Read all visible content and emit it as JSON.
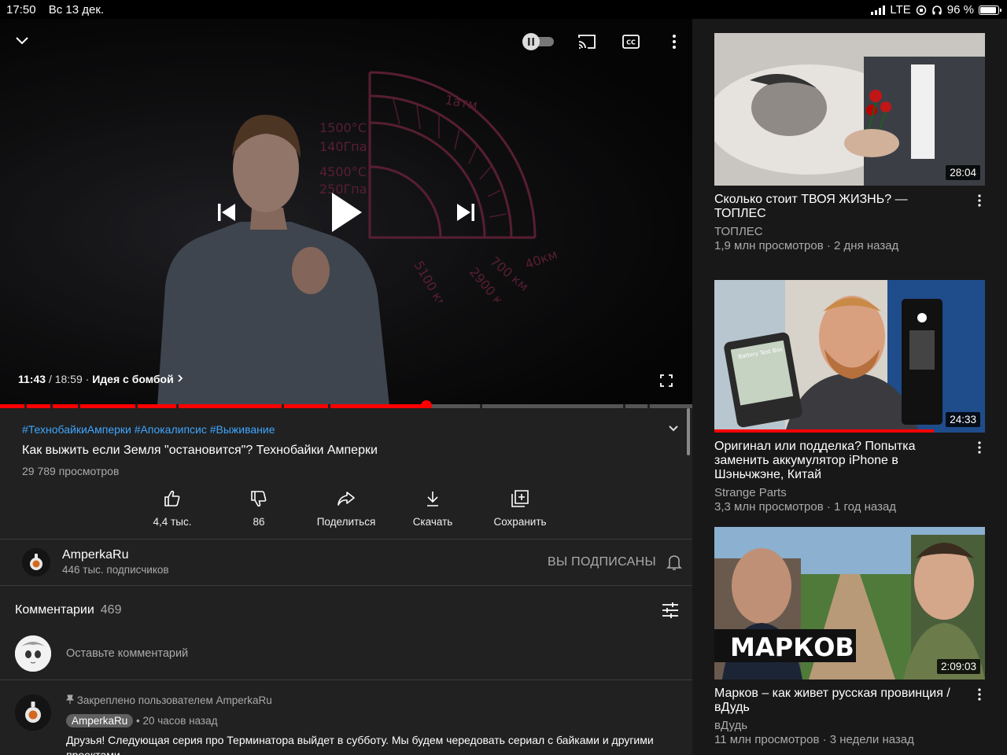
{
  "status_bar": {
    "time": "17:50",
    "date": "Вс 13 дек.",
    "network": "LTE",
    "battery": "96 %",
    "battery_level": 0.96
  },
  "player": {
    "current_time": "11:43",
    "duration": "/ 18:59",
    "separator": "·",
    "chapter": "Идея с бомбой",
    "progress": 0.616,
    "chapter_marks": [
      0.035,
      0.073,
      0.112,
      0.195,
      0.255,
      0.407,
      0.474,
      0.693,
      0.9,
      0.935
    ],
    "board_labels": [
      "1атм",
      "1500°C",
      "140Гпа",
      "4500°C",
      "250Гпа",
      "5100 км",
      "2900 км",
      "700 км",
      "40км"
    ]
  },
  "video": {
    "hashtags": "#ТехнобайкиАмперки #Апокалипсис #Выживание",
    "title": "Как выжить если Земля \"остановится\"? Технобайки Амперки",
    "views": "29 789 просмотров"
  },
  "actions": [
    {
      "icon": "thumbs-up-icon",
      "label": "4,4 тыс."
    },
    {
      "icon": "thumbs-down-icon",
      "label": "86"
    },
    {
      "icon": "share-icon",
      "label": "Поделиться"
    },
    {
      "icon": "download-icon",
      "label": "Скачать"
    },
    {
      "icon": "save-playlist-icon",
      "label": "Сохранить"
    }
  ],
  "channel": {
    "name": "AmperkaRu",
    "subscribers": "446 тыс. подписчиков",
    "subscribed_label": "ВЫ ПОДПИСАНЫ"
  },
  "comments": {
    "title": "Комментарии",
    "count": "469",
    "input_placeholder": "Оставьте комментарий",
    "pinned": {
      "pinned_label": "Закреплено пользователем AmperkaRu",
      "author": "AmperkaRu",
      "time": "• 20 часов назад",
      "text": "Друзья! Следующая серия про Терминатора выйдет в субботу. Мы будем чередовать сериал с байками и другими проектами"
    }
  },
  "sidebar": [
    {
      "title": "Сколько стоит ТВОЯ ЖИЗНЬ? — ТОПЛЕС",
      "channel": "ТОПЛЕС",
      "meta": "1,9 млн просмотров · 2 дня назад",
      "duration": "28:04"
    },
    {
      "title": "Оригинал или подделка? Попытка заменить аккумулятор iPhone в Шэньчжэне, Китай",
      "channel": "Strange Parts",
      "meta": "3,3 млн просмотров · 1 год назад",
      "duration": "24:33",
      "watched": 0.81,
      "thumb_text": "Battery Test Box"
    },
    {
      "title": "Марков – как живет русская провинция / вДудь",
      "channel": "вДудь",
      "meta": "11 млн просмотров · 3 недели назад",
      "duration": "2:09:03",
      "thumb_text": "МАРКОВ"
    }
  ]
}
